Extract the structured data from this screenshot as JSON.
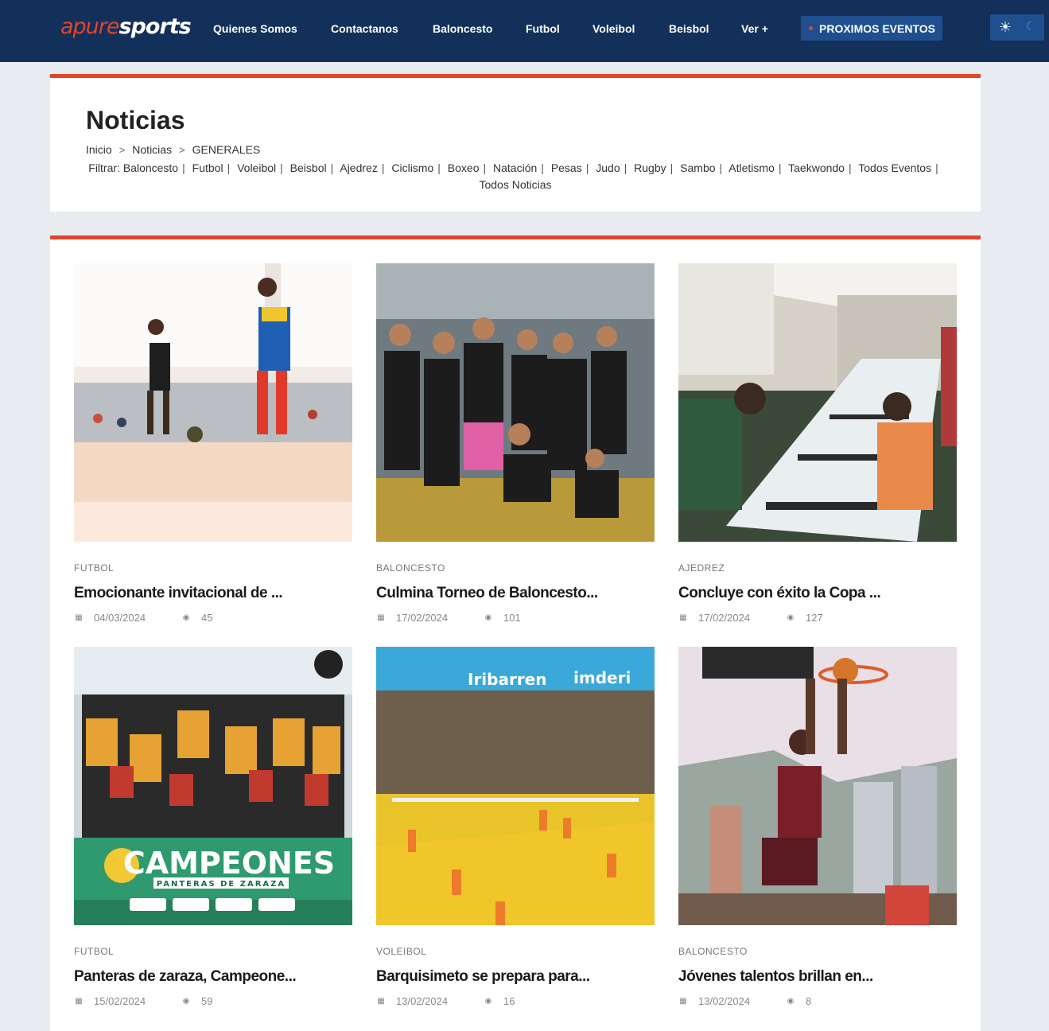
{
  "header": {
    "logo_part1": "apure",
    "logo_part2": "sports",
    "nav": [
      "Quienes Somos",
      "Contactanos",
      "Baloncesto",
      "Futbol",
      "Voleibol",
      "Beisbol",
      "Ver +"
    ],
    "events_button": "PROXIMOS EVENTOS",
    "colors": {
      "bar": "#13305a",
      "accent": "#e0452b",
      "button": "#1f4f8f"
    },
    "icons": {
      "light": "sun-icon",
      "dark": "moon-icon"
    }
  },
  "page": {
    "title": "Noticias",
    "breadcrumb": [
      "Inicio",
      "Noticias",
      "GENERALES"
    ],
    "filter_label": "Filtrar:",
    "filters": [
      "Baloncesto",
      "Futbol",
      "Voleibol",
      "Beisbol",
      "Ajedrez",
      "Ciclismo",
      "Boxeo",
      "Natación",
      "Pesas",
      "Judo",
      "Rugby",
      "Sambo",
      "Atletismo",
      "Taekwondo",
      "Todos Eventos",
      "Todos Noticias"
    ]
  },
  "articles": [
    {
      "category": "FUTBOL",
      "title": "Emocionante invitacional de ...",
      "date": "04/03/2024",
      "views": "45",
      "image": "futsal-kids"
    },
    {
      "category": "BALONCESTO",
      "title": "Culmina Torneo de Baloncesto...",
      "date": "17/02/2024",
      "views": "101",
      "image": "basketball-team"
    },
    {
      "category": "AJEDREZ",
      "title": "Concluye con éxito la Copa ...",
      "date": "17/02/2024",
      "views": "127",
      "image": "chess-tournament"
    },
    {
      "category": "FUTBOL",
      "title": "Panteras de zaraza, Campeone...",
      "date": "15/02/2024",
      "views": "59",
      "image": "campeones-poster"
    },
    {
      "category": "VOLEIBOL",
      "title": "Barquisimeto se prepara para...",
      "date": "13/02/2024",
      "views": "16",
      "image": "volleyball-court"
    },
    {
      "category": "BALONCESTO",
      "title": "Jóvenes talentos brillan en...",
      "date": "13/02/2024",
      "views": "8",
      "image": "basketball-dunk"
    }
  ],
  "poster_text": {
    "headline": "CAMPEONES",
    "subline": "PANTERAS DE ZARAZA",
    "sign1": "Iribarren",
    "sign2": "imderi"
  }
}
